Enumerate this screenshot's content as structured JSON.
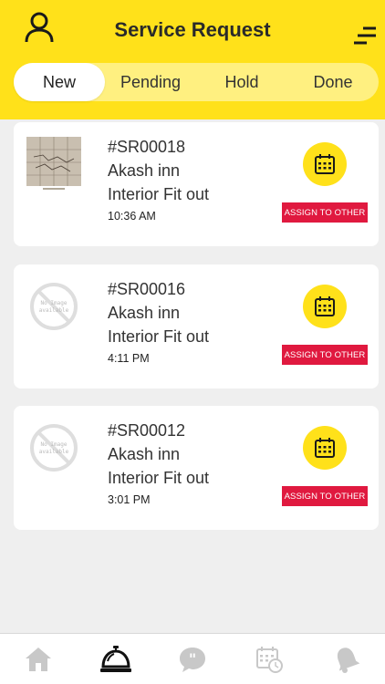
{
  "header": {
    "title": "Service Request",
    "profile_icon": "user-icon",
    "menu_icon": "menu-icon",
    "background_color": "#ffe11a"
  },
  "tabs": [
    {
      "label": "New",
      "active": true
    },
    {
      "label": "Pending",
      "active": false
    },
    {
      "label": "Hold",
      "active": false
    },
    {
      "label": "Done",
      "active": false
    }
  ],
  "requests": [
    {
      "id": "#SR00018",
      "location": "Akash inn",
      "category": "Interior Fit out",
      "time": "10:36 AM",
      "image": "sketch-photo",
      "assign_label": "ASSIGN TO OTHER"
    },
    {
      "id": "#SR00016",
      "location": "Akash inn",
      "category": "Interior Fit out",
      "time": "4:11 PM",
      "image": "no-image-placeholder",
      "assign_label": "ASSIGN TO OTHER"
    },
    {
      "id": "#SR00012",
      "location": "Akash inn",
      "category": "Interior Fit out",
      "time": "3:01 PM",
      "image": "no-image-placeholder",
      "assign_label": "ASSIGN TO OTHER"
    }
  ],
  "placeholder_text": [
    "No Image",
    "available"
  ],
  "bottom_nav": [
    {
      "icon": "home-icon",
      "active": false
    },
    {
      "icon": "service-bell-icon",
      "active": true
    },
    {
      "icon": "chat-icon",
      "active": false
    },
    {
      "icon": "calendar-clock-icon",
      "active": false
    },
    {
      "icon": "notification-bell-icon",
      "active": false
    }
  ],
  "colors": {
    "accent": "#ffe11a",
    "assign_button": "#e0193f",
    "inactive_icon": "#c8c8c8"
  }
}
